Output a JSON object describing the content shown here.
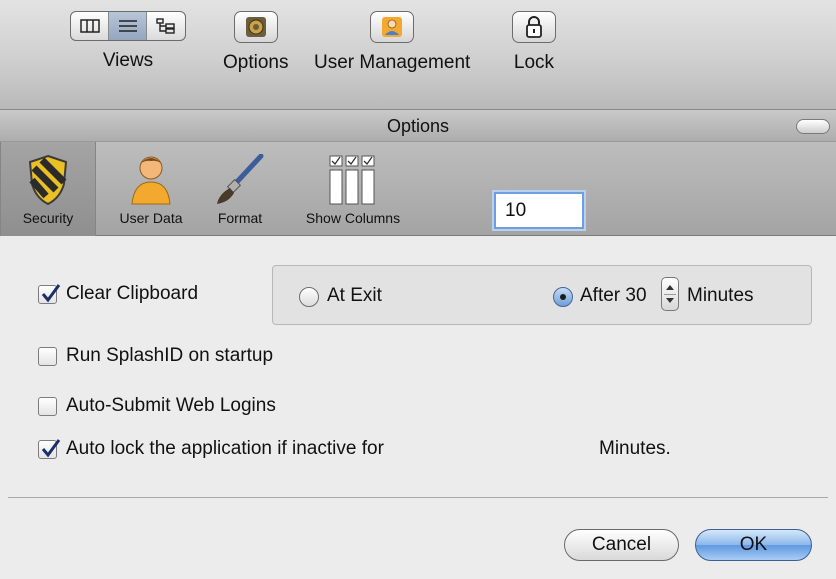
{
  "main_toolbar": {
    "views_label": "Views",
    "options_label": "Options",
    "user_management_label": "User Management",
    "lock_label": "Lock"
  },
  "options_panel": {
    "title": "Options",
    "tabs": {
      "security": "Security",
      "user_data": "User Data",
      "format": "Format",
      "show_columns": "Show Columns"
    },
    "selected_tab": "Security"
  },
  "security": {
    "clear_clipboard": {
      "label": "Clear Clipboard",
      "checked": true
    },
    "at_exit": {
      "label": "At Exit",
      "selected": false
    },
    "after": {
      "label": "After 30",
      "selected": true,
      "minutes_label": "Minutes"
    },
    "run_on_startup": {
      "label": "Run SplashID on startup",
      "checked": false
    },
    "auto_submit": {
      "label": "Auto-Submit Web Logins",
      "checked": false
    },
    "auto_lock": {
      "label": "Auto lock the application if inactive for",
      "checked": true,
      "value": "10",
      "suffix": "Minutes."
    }
  },
  "buttons": {
    "cancel": "Cancel",
    "ok": "OK"
  },
  "colors": {
    "accent": "#6f9ed6",
    "ok_button": "#5f98e1",
    "focus_ring": "#6e9fdc"
  }
}
